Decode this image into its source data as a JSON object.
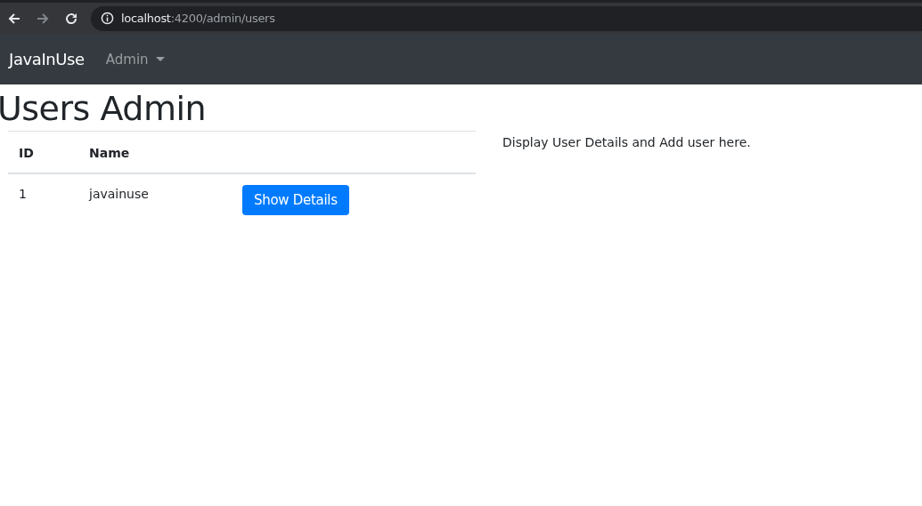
{
  "browser": {
    "url_host": "localhost",
    "url_path": ":4200/admin/users"
  },
  "navbar": {
    "brand": "JavaInUse",
    "menu": "Admin"
  },
  "page": {
    "title": "Users Admin"
  },
  "table": {
    "columns": [
      "ID",
      "Name"
    ],
    "rows": [
      {
        "id": "1",
        "name": "javainuse",
        "action": "Show Details"
      }
    ]
  },
  "side_text": "Display User Details and Add user here."
}
